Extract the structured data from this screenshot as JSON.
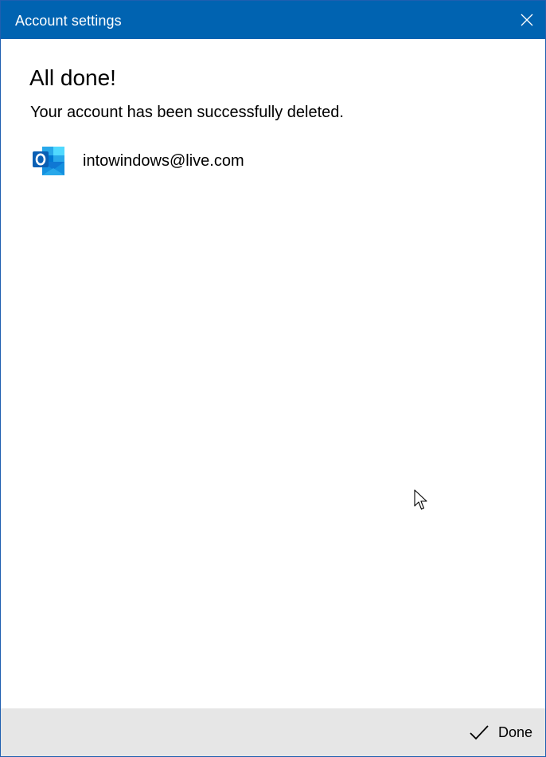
{
  "window": {
    "title": "Account settings"
  },
  "main": {
    "heading": "All done!",
    "message": "Your account has been successfully deleted.",
    "account": {
      "email": "intowindows@live.com",
      "icon": "outlook-icon"
    }
  },
  "footer": {
    "done_label": "Done",
    "done_icon": "checkmark-icon"
  },
  "colors": {
    "titlebar": "#0063b1",
    "footer": "#e6e6e6",
    "outlook_blue": "#0a64c8"
  }
}
